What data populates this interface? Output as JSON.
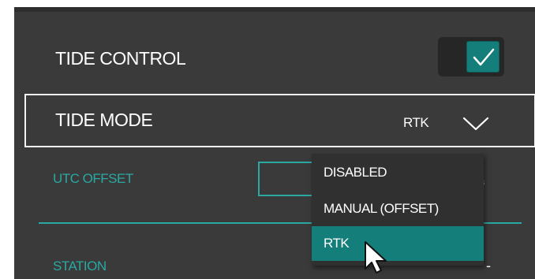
{
  "tide_control": {
    "label": "TIDE CONTROL",
    "toggle_on": true,
    "toggle_icon": "checkmark-icon"
  },
  "tide_mode": {
    "label": "TIDE MODE",
    "value": "RTK",
    "chevron_icon": "chevron-down-icon"
  },
  "utc_offset": {
    "label": "UTC OFFSET",
    "value": "",
    "suffix": "s"
  },
  "station": {
    "label": "STATION",
    "value": "-"
  },
  "dropdown": {
    "options": [
      "DISABLED",
      "MANUAL (OFFSET)",
      "RTK"
    ],
    "selected": "RTK"
  },
  "colors": {
    "panel_bg": "#3a3a3a",
    "accent": "#147f7a",
    "accent_text": "#2aa8a2",
    "text": "#ffffff"
  }
}
